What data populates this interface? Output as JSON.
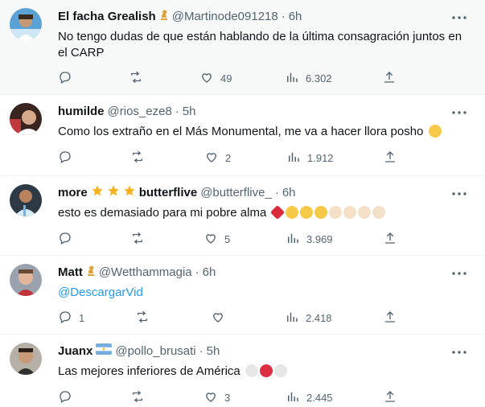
{
  "colors": {
    "secondary": "#536471",
    "accent": "#1d9bf0",
    "highlight_bg": "#f7f9f9",
    "divider": "#eff3f4"
  },
  "tweets": [
    {
      "name": "El facha Grealish",
      "handle": "@Martinode091218",
      "time": "6h",
      "badge_icon": "chess-knight-icon",
      "text": "No tengo dudas de que están hablando de la última consagración juntos en el CARP",
      "replies": "",
      "retweets": "",
      "likes": "49",
      "views": "6.302"
    },
    {
      "name": "humilde",
      "handle": "@rios_eze8",
      "time": "5h",
      "text": "Como los extraño en el Más Monumental, me va a hacer llora posho",
      "trailing_emoji": "relieved-face-emoji",
      "replies": "",
      "retweets": "",
      "likes": "2",
      "views": "1.912"
    },
    {
      "name_prefix": "more",
      "name_suffix": "butterflive",
      "name_icons": [
        "star-icon",
        "star-icon",
        "star-icon"
      ],
      "handle": "@butterflive_",
      "time": "6h",
      "text": "esto es demasiado para mi pobre alma",
      "trailing_emoji": "heart-and-smiley-emojis",
      "replies": "",
      "retweets": "",
      "likes": "5",
      "views": "3.969"
    },
    {
      "name": "Matt",
      "badge_icon": "chess-knight-icon",
      "handle": "@Wetthammagia",
      "time": "6h",
      "text": "@DescargarVid",
      "replies": "1",
      "retweets": "",
      "likes": "",
      "views": "2.418"
    },
    {
      "name": "Juanx",
      "badge_icon": "argentina-flag-icon",
      "handle": "@pollo_brusati",
      "time": "5h",
      "text": "Las mejores inferiores de América",
      "trailing_emoji": "white-red-white-circles",
      "replies": "",
      "retweets": "",
      "likes": "3",
      "views": "2.445"
    }
  ],
  "separator": "·"
}
